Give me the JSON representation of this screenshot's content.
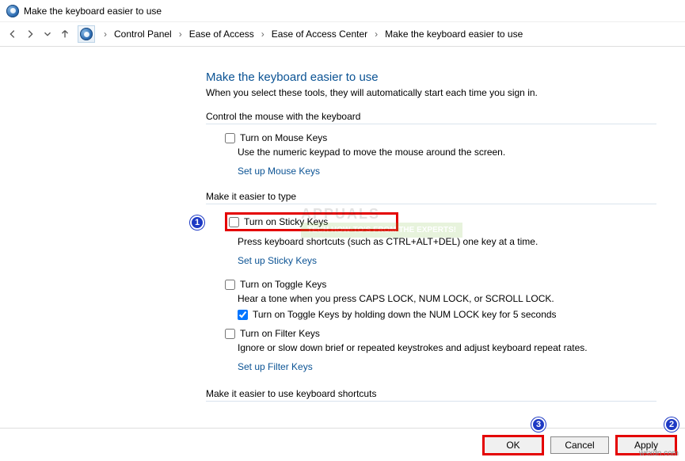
{
  "window_title": "Make the keyboard easier to use",
  "breadcrumb": [
    "Control Panel",
    "Ease of Access",
    "Ease of Access Center",
    "Make the keyboard easier to use"
  ],
  "heading": "Make the keyboard easier to use",
  "subheading": "When you select these tools, they will automatically start each time you sign in.",
  "sections": {
    "mouse_ctrl": {
      "title": "Control the mouse with the keyboard",
      "mouse_keys": {
        "label": "Turn on Mouse Keys",
        "checked": false,
        "desc": "Use the numeric keypad to move the mouse around the screen."
      },
      "link": "Set up Mouse Keys"
    },
    "easier_type": {
      "title": "Make it easier to type",
      "sticky": {
        "label": "Turn on Sticky Keys",
        "checked": false,
        "desc": "Press keyboard shortcuts (such as CTRL+ALT+DEL) one key at a time."
      },
      "sticky_link": "Set up Sticky Keys",
      "toggle": {
        "label": "Turn on Toggle Keys",
        "checked": false,
        "desc": "Hear a tone when you press CAPS LOCK, NUM LOCK, or SCROLL LOCK."
      },
      "toggle_hold": {
        "label": "Turn on Toggle Keys by holding down the NUM LOCK key for 5 seconds",
        "checked": true
      },
      "filter": {
        "label": "Turn on Filter Keys",
        "checked": false,
        "desc": "Ignore or slow down brief or repeated keystrokes and adjust keyboard repeat rates."
      },
      "filter_link": "Set up Filter Keys"
    },
    "shortcuts": {
      "title": "Make it easier to use keyboard shortcuts"
    }
  },
  "buttons": {
    "ok": "OK",
    "cancel": "Cancel",
    "apply": "Apply"
  },
  "callouts": {
    "sticky": "1",
    "apply": "2",
    "ok": "3"
  },
  "watermark": "wsxdn.com",
  "wm_logo": {
    "name": "APPUALS",
    "tag": "TECH HOW-TO'S FROM THE EXPERTS!"
  }
}
